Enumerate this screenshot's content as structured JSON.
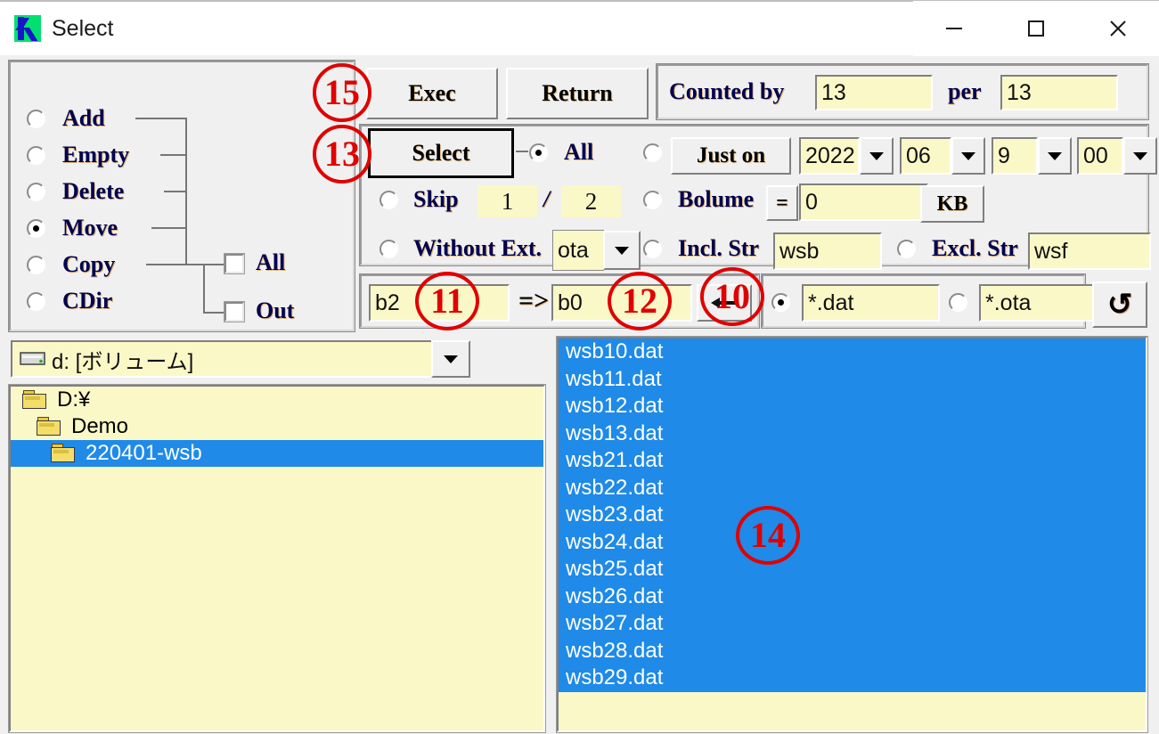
{
  "window": {
    "title": "Select",
    "icon": "app-k-logo",
    "buttons": {
      "minimize": "–",
      "maximize": "□",
      "close": "✕"
    }
  },
  "mode_group": {
    "options": [
      {
        "label": "Add",
        "selected": false
      },
      {
        "label": "Empty",
        "selected": false
      },
      {
        "label": "Delete",
        "selected": false
      },
      {
        "label": "Move",
        "selected": true
      },
      {
        "label": "Copy",
        "selected": false
      },
      {
        "label": "CDir",
        "selected": false
      }
    ],
    "checkboxes": [
      {
        "label": "All",
        "checked": false
      },
      {
        "label": "Out",
        "checked": false
      }
    ]
  },
  "actions": {
    "exec_label": "Exec",
    "return_label": "Return",
    "select_label": "Select"
  },
  "counter": {
    "counted_by_label": "Counted by",
    "counted_by_value": "13",
    "per_label": "per",
    "per_value": "13"
  },
  "filters": {
    "all": {
      "label": "All",
      "selected": true
    },
    "just_on": {
      "label": "Just on",
      "selected": false,
      "year": "2022",
      "month": "06",
      "day": "9",
      "hour": "00"
    },
    "skip": {
      "label": "Skip",
      "selected": false,
      "from": "1",
      "separator": "/",
      "to": "2"
    },
    "volume": {
      "label": "Bolume",
      "selected": false,
      "eq": "=",
      "value": "0",
      "unit": "KB"
    },
    "without_ext": {
      "label": "Without Ext.",
      "selected": false,
      "value": "ota"
    },
    "incl_str": {
      "label": "Incl. Str",
      "selected": false,
      "value": "wsb"
    },
    "excl_str": {
      "label": "Excl. Str",
      "selected": false,
      "value": "wsf"
    }
  },
  "rename": {
    "from_value": "b2",
    "arrow": "=>",
    "to_value": "b0",
    "apply_icon": "left-arrow-icon"
  },
  "patterns": {
    "primary": {
      "value": "*.dat",
      "selected": true
    },
    "secondary": {
      "value": "*.ota",
      "selected": false
    },
    "refresh_icon": "↺"
  },
  "drive": {
    "value": "d: [ボリューム]"
  },
  "tree": {
    "items": [
      {
        "label": "D:¥",
        "indent": 0,
        "selected": false
      },
      {
        "label": "Demo",
        "indent": 1,
        "selected": false
      },
      {
        "label": "220401-wsb",
        "indent": 2,
        "selected": true
      }
    ]
  },
  "file_list": {
    "items": [
      "wsb10.dat",
      "wsb11.dat",
      "wsb12.dat",
      "wsb13.dat",
      "wsb21.dat",
      "wsb22.dat",
      "wsb23.dat",
      "wsb24.dat",
      "wsb25.dat",
      "wsb26.dat",
      "wsb27.dat",
      "wsb28.dat",
      "wsb29.dat"
    ]
  },
  "annotations": [
    {
      "number": "15"
    },
    {
      "number": "13"
    },
    {
      "number": "11"
    },
    {
      "number": "12"
    },
    {
      "number": "10"
    },
    {
      "number": "14"
    }
  ],
  "colors": {
    "field_yellow": "#fbf8c8",
    "selection_blue": "#1f8ae8",
    "annotation_red": "#e00000",
    "panel_gray": "#f0f0f0"
  }
}
